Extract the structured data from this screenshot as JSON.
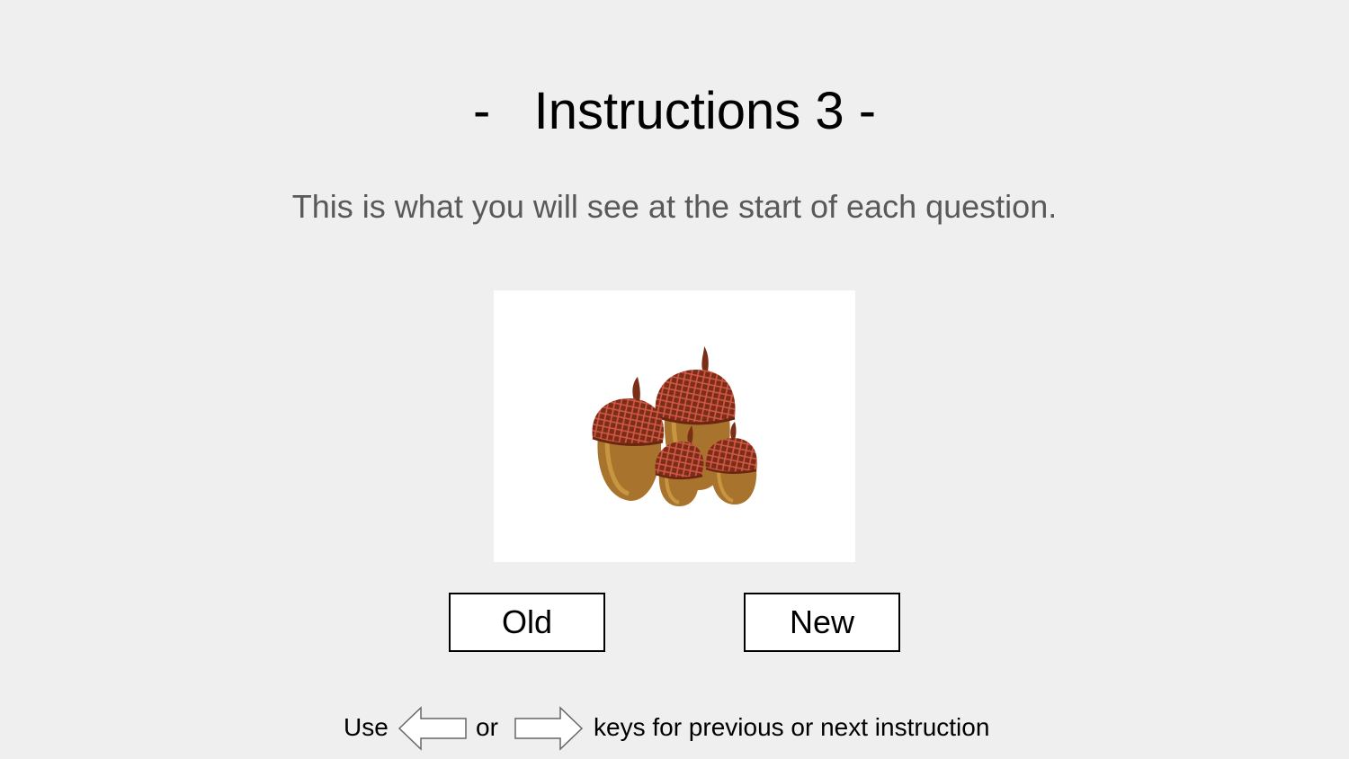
{
  "title": "-   Instructions 3 -",
  "subtitle": "This is what you will see at the start of each question.",
  "stimulus": {
    "icon": "acorns-icon"
  },
  "buttons": {
    "old_label": "Old",
    "new_label": "New"
  },
  "footer": {
    "use_text": "Use",
    "left_key_icon": "left-arrow-key-icon",
    "or_text": "or",
    "right_key_icon": "right-arrow-key-icon",
    "rest_text": "keys for previous or next instruction"
  },
  "colors": {
    "background": "#efefef",
    "subtitle_text": "#595959",
    "acorn_cap": "#7a2e15",
    "acorn_body": "#a8732c"
  }
}
